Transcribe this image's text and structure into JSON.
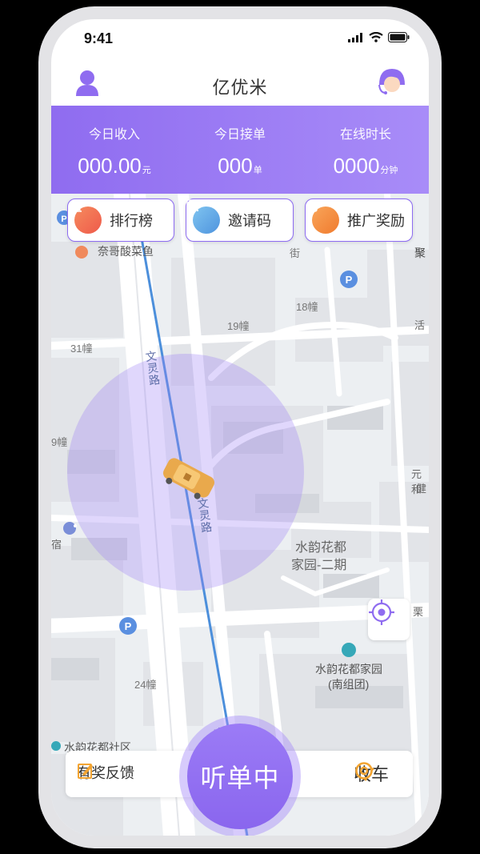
{
  "status_bar": {
    "time": "9:41"
  },
  "header": {
    "title": "亿优米",
    "avatar_icon": "driver-avatar-icon",
    "service_icon": "customer-service-icon"
  },
  "stats": [
    {
      "label": "今日收入",
      "value": "000.00",
      "unit": "元"
    },
    {
      "label": "今日接单",
      "value": "000",
      "unit": "单"
    },
    {
      "label": "在线时长",
      "value": "0000",
      "unit": "分钟"
    }
  ],
  "chips": [
    {
      "label": "排行榜",
      "icon": "ranking-chart-icon",
      "color": "#f26c45"
    },
    {
      "label": "邀请码",
      "icon": "qr-code-icon",
      "color": "#5aa9e6"
    },
    {
      "label": "推广奖励",
      "icon": "share-icon",
      "color": "#f5893b"
    }
  ],
  "map": {
    "poi": [
      "奈哥酸菜鱼",
      "18幢",
      "19幢",
      "31幢",
      "文灵路",
      "文灵路",
      "9幢",
      "水韵花都",
      "家园-二期",
      "24幢",
      "水韵花都家园",
      "(南组团)",
      "水韵花都社区",
      "元和",
      "健",
      "活",
      "聚",
      "栗",
      "宿",
      "文",
      "街"
    ]
  },
  "bottom": {
    "feedback_label": "有奖反馈",
    "listen_label": "听单中",
    "close_label": "收车"
  },
  "colors": {
    "accent": "#8f6cf0",
    "taxi": "#f0b85a"
  }
}
